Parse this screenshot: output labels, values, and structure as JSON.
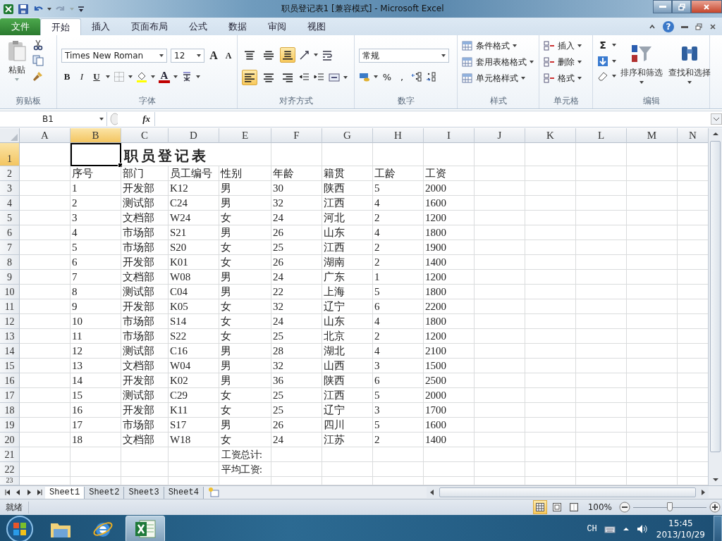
{
  "title_bar": {
    "title": "职员登记表1  [兼容模式]  -  Microsoft Excel"
  },
  "ribbon_tabs": [
    {
      "label": "文件",
      "kind": "file",
      "selected": false
    },
    {
      "label": "开始",
      "kind": "tab",
      "selected": true
    },
    {
      "label": "插入",
      "kind": "tab",
      "selected": false
    },
    {
      "label": "页面布局",
      "kind": "tab",
      "selected": false
    },
    {
      "label": "公式",
      "kind": "tab",
      "selected": false
    },
    {
      "label": "数据",
      "kind": "tab",
      "selected": false
    },
    {
      "label": "审阅",
      "kind": "tab",
      "selected": false
    },
    {
      "label": "视图",
      "kind": "tab",
      "selected": false
    }
  ],
  "help": "?",
  "clipboard": {
    "paste": "粘贴",
    "label": "剪贴板"
  },
  "font": {
    "name": "Times New Roman",
    "size": "12",
    "grow": "A",
    "shrink": "A",
    "color_letter": "A",
    "label": "字体",
    "styles": [
      {
        "label": "B",
        "kind": "bold"
      },
      {
        "label": "I",
        "kind": "italic"
      },
      {
        "label": "U",
        "kind": "underline"
      }
    ]
  },
  "alignment": {
    "label": "对齐方式",
    "vertical": [
      {
        "kind": "top",
        "selected": false
      },
      {
        "kind": "middle",
        "selected": false
      },
      {
        "kind": "bottom",
        "selected": true
      }
    ],
    "horizontal": [
      {
        "kind": "left",
        "selected": true
      },
      {
        "kind": "center",
        "selected": false
      },
      {
        "kind": "right",
        "selected": false
      }
    ]
  },
  "number": {
    "format": "常规",
    "percent": "%",
    "comma": ",",
    "label": "数字"
  },
  "styles": {
    "items": [
      "条件格式",
      "套用表格格式",
      "单元格样式"
    ],
    "label": "样式"
  },
  "cells_group": {
    "items": [
      "插入",
      "删除",
      "格式"
    ],
    "label": "单元格"
  },
  "editing": {
    "sum": "Σ",
    "sort": "排序和筛选",
    "find": "查找和选择",
    "label": "编辑"
  },
  "formula_bar": {
    "name_box": "B1",
    "fx": "fx"
  },
  "columns": [
    {
      "label": "A",
      "selected": false
    },
    {
      "label": "B",
      "selected": true
    },
    {
      "label": "C",
      "selected": false
    },
    {
      "label": "D",
      "selected": false
    },
    {
      "label": "E",
      "selected": false
    },
    {
      "label": "F",
      "selected": false
    },
    {
      "label": "G",
      "selected": false
    },
    {
      "label": "H",
      "selected": false
    },
    {
      "label": "I",
      "selected": false
    },
    {
      "label": "J",
      "selected": false
    },
    {
      "label": "K",
      "selected": false
    },
    {
      "label": "L",
      "selected": false
    },
    {
      "label": "M",
      "selected": false
    },
    {
      "label": "N",
      "selected": false
    }
  ],
  "row_headers": [
    {
      "label": "1",
      "selected": true
    },
    {
      "label": "2",
      "selected": false
    },
    {
      "label": "3",
      "selected": false
    },
    {
      "label": "4",
      "selected": false
    },
    {
      "label": "5",
      "selected": false
    },
    {
      "label": "6",
      "selected": false
    },
    {
      "label": "7",
      "selected": false
    },
    {
      "label": "8",
      "selected": false
    },
    {
      "label": "9",
      "selected": false
    },
    {
      "label": "10",
      "selected": false
    },
    {
      "label": "11",
      "selected": false
    },
    {
      "label": "12",
      "selected": false
    },
    {
      "label": "13",
      "selected": false
    },
    {
      "label": "14",
      "selected": false
    },
    {
      "label": "15",
      "selected": false
    },
    {
      "label": "16",
      "selected": false
    },
    {
      "label": "17",
      "selected": false
    },
    {
      "label": "18",
      "selected": false
    },
    {
      "label": "19",
      "selected": false
    },
    {
      "label": "20",
      "selected": false
    },
    {
      "label": "21",
      "selected": false
    },
    {
      "label": "22",
      "selected": false
    },
    {
      "label": "23",
      "selected": false
    }
  ],
  "sheet_title": "职员登记表",
  "table": {
    "header": [
      "序号",
      "部门",
      "员工编号",
      "性别",
      "年龄",
      "籍贯",
      "工龄",
      "工资"
    ],
    "rows": [
      [
        "1",
        "开发部",
        "K12",
        "男",
        "30",
        "陕西",
        "5",
        "2000"
      ],
      [
        "2",
        "测试部",
        "C24",
        "男",
        "32",
        "江西",
        "4",
        "1600"
      ],
      [
        "3",
        "文档部",
        "W24",
        "女",
        "24",
        "河北",
        "2",
        "1200"
      ],
      [
        "4",
        "市场部",
        "S21",
        "男",
        "26",
        "山东",
        "4",
        "1800"
      ],
      [
        "5",
        "市场部",
        "S20",
        "女",
        "25",
        "江西",
        "2",
        "1900"
      ],
      [
        "6",
        "开发部",
        "K01",
        "女",
        "26",
        "湖南",
        "2",
        "1400"
      ],
      [
        "7",
        "文档部",
        "W08",
        "男",
        "24",
        "广东",
        "1",
        "1200"
      ],
      [
        "8",
        "测试部",
        "C04",
        "男",
        "22",
        "上海",
        "5",
        "1800"
      ],
      [
        "9",
        "开发部",
        "K05",
        "女",
        "32",
        "辽宁",
        "6",
        "2200"
      ],
      [
        "10",
        "市场部",
        "S14",
        "女",
        "24",
        "山东",
        "4",
        "1800"
      ],
      [
        "11",
        "市场部",
        "S22",
        "女",
        "25",
        "北京",
        "2",
        "1200"
      ],
      [
        "12",
        "测试部",
        "C16",
        "男",
        "28",
        "湖北",
        "4",
        "2100"
      ],
      [
        "13",
        "文档部",
        "W04",
        "男",
        "32",
        "山西",
        "3",
        "1500"
      ],
      [
        "14",
        "开发部",
        "K02",
        "男",
        "36",
        "陕西",
        "6",
        "2500"
      ],
      [
        "15",
        "测试部",
        "C29",
        "女",
        "25",
        "江西",
        "5",
        "2000"
      ],
      [
        "16",
        "开发部",
        "K11",
        "女",
        "25",
        "辽宁",
        "3",
        "1700"
      ],
      [
        "17",
        "市场部",
        "S17",
        "男",
        "26",
        "四川",
        "5",
        "1600"
      ],
      [
        "18",
        "文档部",
        "W18",
        "女",
        "24",
        "江苏",
        "2",
        "1400"
      ]
    ]
  },
  "summary": [
    "工资总计:",
    "平均工资:"
  ],
  "sheet_tabs": [
    {
      "label": "Sheet1",
      "selected": true
    },
    {
      "label": "Sheet2",
      "selected": false
    },
    {
      "label": "Sheet3",
      "selected": false
    },
    {
      "label": "Sheet4",
      "selected": false
    }
  ],
  "status_bar": {
    "text": "就绪",
    "views": [
      {
        "kind": "normal",
        "selected": true
      },
      {
        "kind": "layout",
        "selected": false
      },
      {
        "kind": "break",
        "selected": false
      }
    ],
    "zoom": "100%",
    "zoom_slider": {
      "level": 0.5
    }
  },
  "taskbar": {
    "apps": [
      {
        "kind": "explorer",
        "selected": false
      },
      {
        "kind": "ie",
        "selected": false
      },
      {
        "kind": "excel",
        "selected": true
      }
    ],
    "language": "CH",
    "time": "15:45",
    "date": "2013/10/29"
  }
}
